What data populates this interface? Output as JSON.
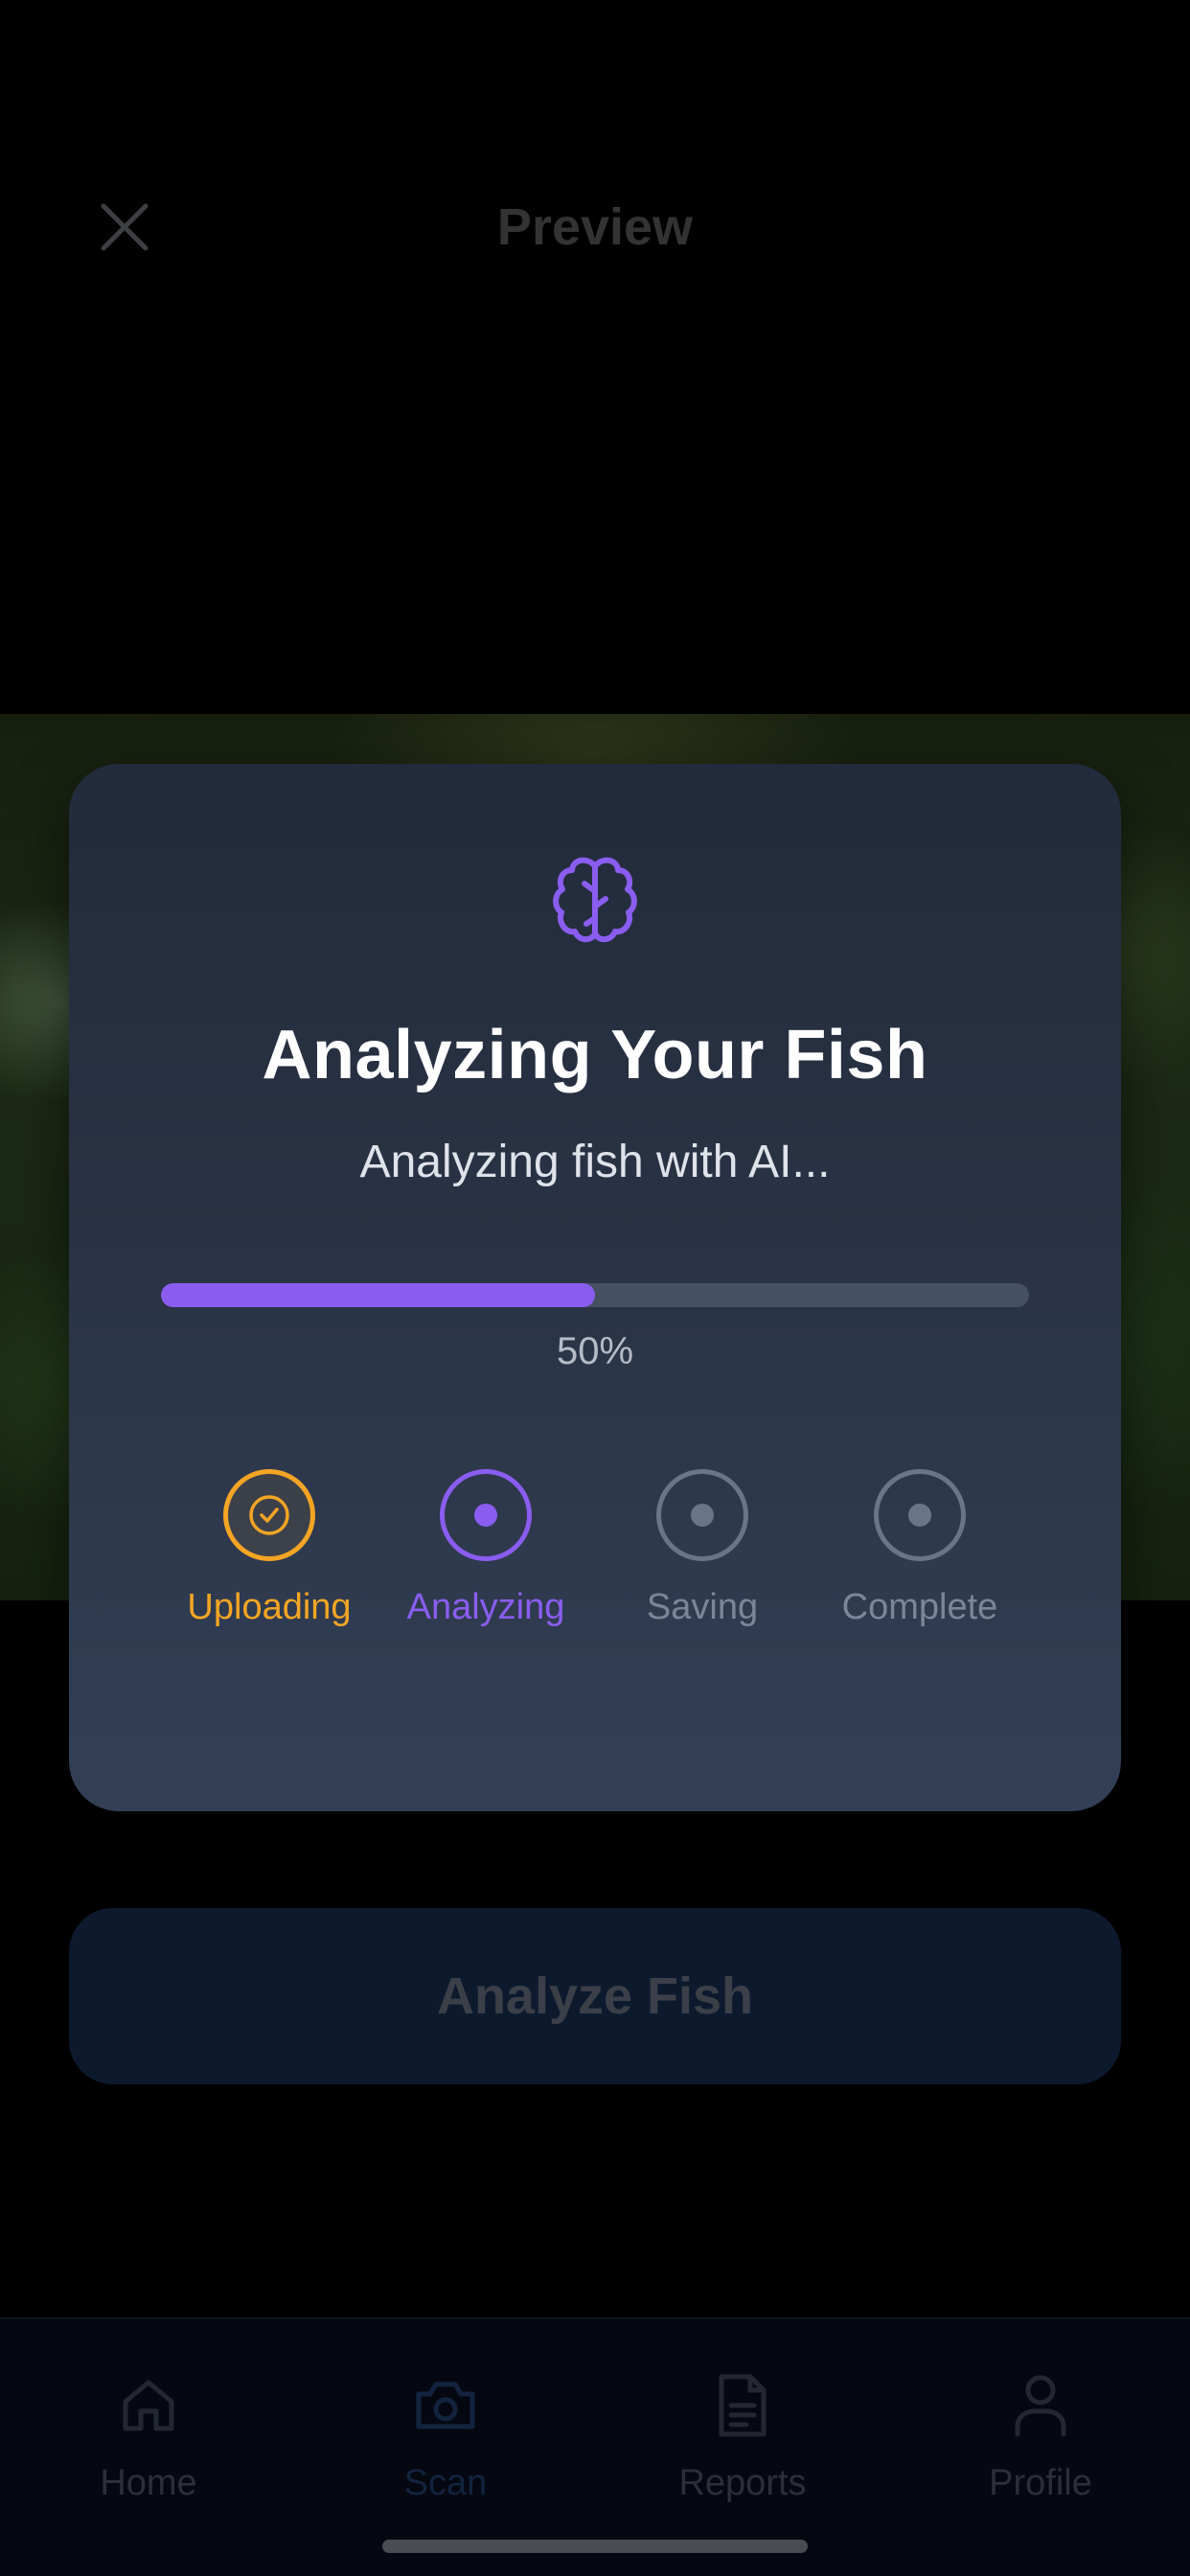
{
  "header": {
    "title": "Preview",
    "close_icon": "close-icon"
  },
  "photo": {
    "description": "fish-photo"
  },
  "modal": {
    "icon": "brain-icon",
    "title": "Analyzing Your Fish",
    "subtitle": "Analyzing fish with AI...",
    "progress_fraction": 0.5,
    "progress_label": "50%",
    "steps": [
      {
        "label": "Uploading",
        "state": "done",
        "icon": "check-icon"
      },
      {
        "label": "Analyzing",
        "state": "active",
        "icon": "dot-icon"
      },
      {
        "label": "Saving",
        "state": "pending",
        "icon": "dot-icon"
      },
      {
        "label": "Complete",
        "state": "pending",
        "icon": "dot-icon"
      }
    ],
    "colors": {
      "done": "#f4a524",
      "active": "#8a5df0",
      "pending": "#6b7588"
    }
  },
  "analyze_button": {
    "label": "Analyze Fish"
  },
  "tabbar": {
    "items": [
      {
        "label": "Home",
        "icon": "home-icon"
      },
      {
        "label": "Scan",
        "icon": "camera-icon",
        "active": true
      },
      {
        "label": "Reports",
        "icon": "document-icon"
      },
      {
        "label": "Profile",
        "icon": "user-icon"
      }
    ]
  }
}
